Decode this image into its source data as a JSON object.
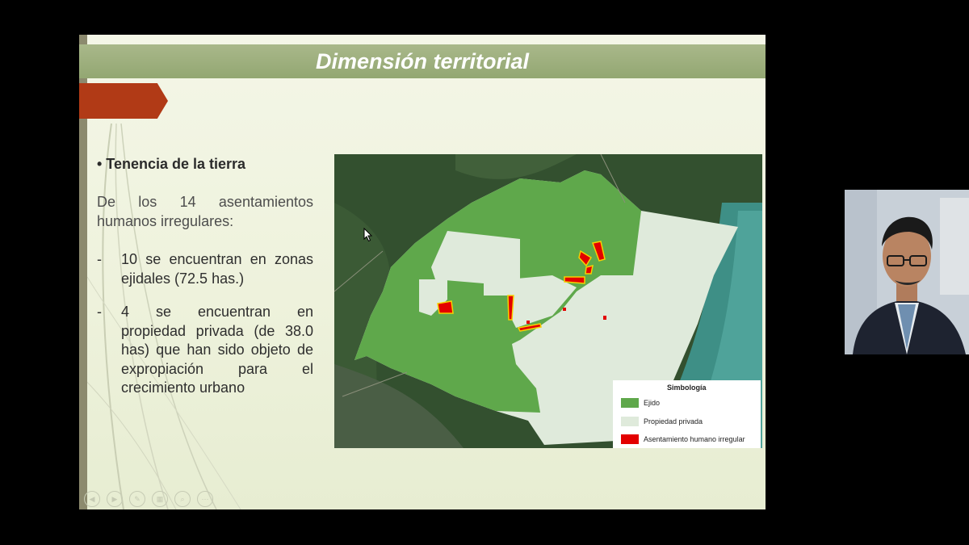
{
  "slide": {
    "title": "Dimensión territorial",
    "bullet_heading": "• Tenencia de la tierra",
    "intro": "De los 14 asentamientos humanos irregulares:",
    "items": [
      {
        "dash": "-",
        "text": "10 se encuentran en zonas ejidales (72.5 has.)"
      },
      {
        "dash": "-",
        "text": "4 se encuentran en propiedad privada (de 38.0 has) que han sido objeto de expropiación para el crecimiento urbano"
      }
    ]
  },
  "map": {
    "legend": {
      "title": "Simbología",
      "items": [
        {
          "label": "Ejido",
          "color": "#5fa84b"
        },
        {
          "label": "Propiedad privada",
          "color": "#dfeadb"
        },
        {
          "label": "Asentamiento humano irregular",
          "color": "#e30000"
        }
      ]
    },
    "colors": {
      "satellite": "#2f4a2e",
      "sea": "#3e8f86"
    }
  },
  "theme": {
    "accent": "#b13a16",
    "title_bar": "#9fb07f",
    "slide_bg": "#f1f4e2"
  },
  "controls": [
    "prev-icon",
    "next-icon",
    "pen-icon",
    "slides-icon",
    "zoom-icon",
    "more-icon"
  ]
}
